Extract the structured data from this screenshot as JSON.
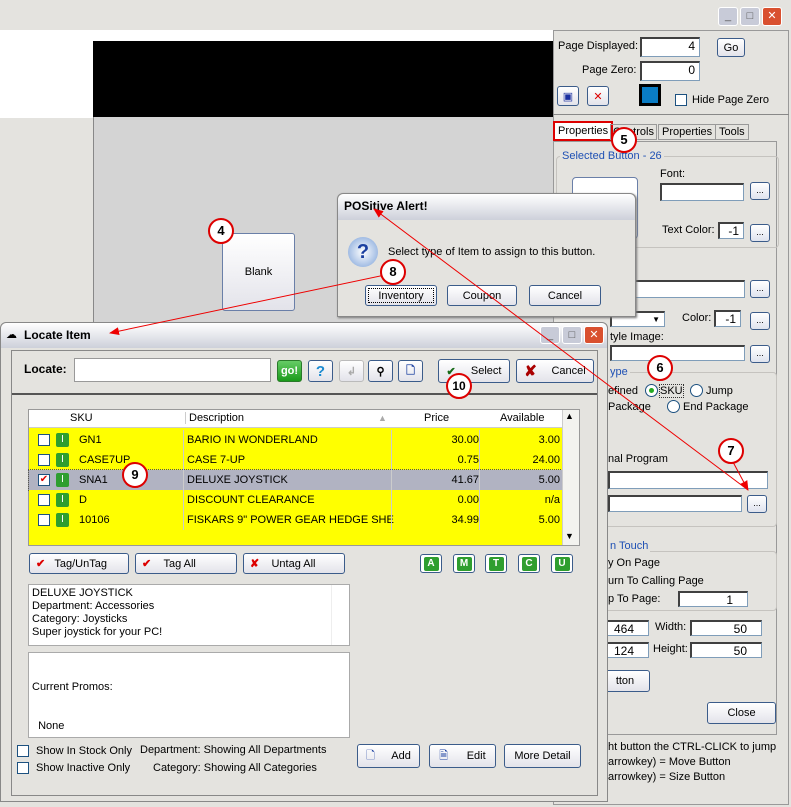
{
  "main": {
    "page_displayed_label": "Page Displayed:",
    "page_displayed": "4",
    "go": "Go",
    "page_zero_label": "Page Zero:",
    "page_zero": "0",
    "hide_page_zero": "Hide Page Zero",
    "tabs": [
      "Properties",
      "Controls",
      "Properties",
      "Tools"
    ],
    "selected_button": "Selected Button - 26",
    "font_label": "Font:",
    "text_color_label": "Text Color:",
    "text_color": "-1",
    "color_label": "Color:",
    "color": "-1",
    "style_image": "tyle Image:",
    "type_group": "ype",
    "radios": [
      "efined",
      "SKU",
      "Jump",
      "Package",
      "End Package"
    ],
    "external_program": "nal Program",
    "on_touch_group": "n Touch",
    "on_touch": [
      "y On Page",
      "urn To Calling Page",
      "p To Page:"
    ],
    "jump_page": "1",
    "left": "464",
    "top": "124",
    "width_label": "Width:",
    "width": "50",
    "height_label": "Height:",
    "height": "50",
    "button_label": "tton",
    "close": "Close",
    "help": [
      "ht button the CTRL-CLICK to jump",
      "arrowkey) = Move Button",
      "arrowkey) = Size Button"
    ],
    "ellipsis": "...",
    "blank_button": "Blank",
    "accent_color": "#0a7cc4"
  },
  "alert": {
    "title": "POSitive Alert!",
    "message": "Select type of Item to assign to this button.",
    "buttons": [
      "Inventory",
      "Coupon",
      "Cancel"
    ]
  },
  "locate": {
    "title": "Locate Item",
    "locate_label": "Locate:",
    "locate_value": "",
    "go": "go!",
    "select": "Select",
    "cancel": "Cancel",
    "columns": [
      "SKU",
      "Description",
      "Price",
      "Available"
    ],
    "rows": [
      {
        "sku": "GN1",
        "desc": "BARIO IN WONDERLAND",
        "price": "30.00",
        "avail": "3.00",
        "checked": false
      },
      {
        "sku": "CASE7UP",
        "desc": "CASE 7-UP",
        "price": "0.75",
        "avail": "24.00",
        "checked": false
      },
      {
        "sku": "SNA1",
        "desc": "DELUXE JOYSTICK",
        "price": "41.67",
        "avail": "5.00",
        "checked": true
      },
      {
        "sku": "D",
        "desc": "DISCOUNT CLEARANCE",
        "price": "0.00",
        "avail": "n/a",
        "checked": false
      },
      {
        "sku": "10106",
        "desc": "FISKARS 9\" POWER GEAR HEDGE SHE",
        "price": "34.99",
        "avail": "5.00",
        "checked": false
      }
    ],
    "tag": "Tag/UnTag",
    "tag_all": "Tag All",
    "untag_all": "Untag All",
    "letters": [
      "A",
      "M",
      "T",
      "C",
      "U"
    ],
    "info": [
      "DELUXE JOYSTICK",
      "Department: Accessories",
      "Category: Joysticks",
      "Super joystick for your PC!"
    ],
    "promos": [
      "Current Promos:",
      "  None"
    ],
    "in_stock": "Show In Stock Only",
    "inactive": "Show Inactive Only",
    "department": "Department: Showing All Departments",
    "category": "Category: Showing All Categories",
    "add": "Add",
    "edit": "Edit",
    "more": "More Detail"
  },
  "callouts": [
    "4",
    "5",
    "6",
    "7",
    "8",
    "9",
    "10"
  ]
}
